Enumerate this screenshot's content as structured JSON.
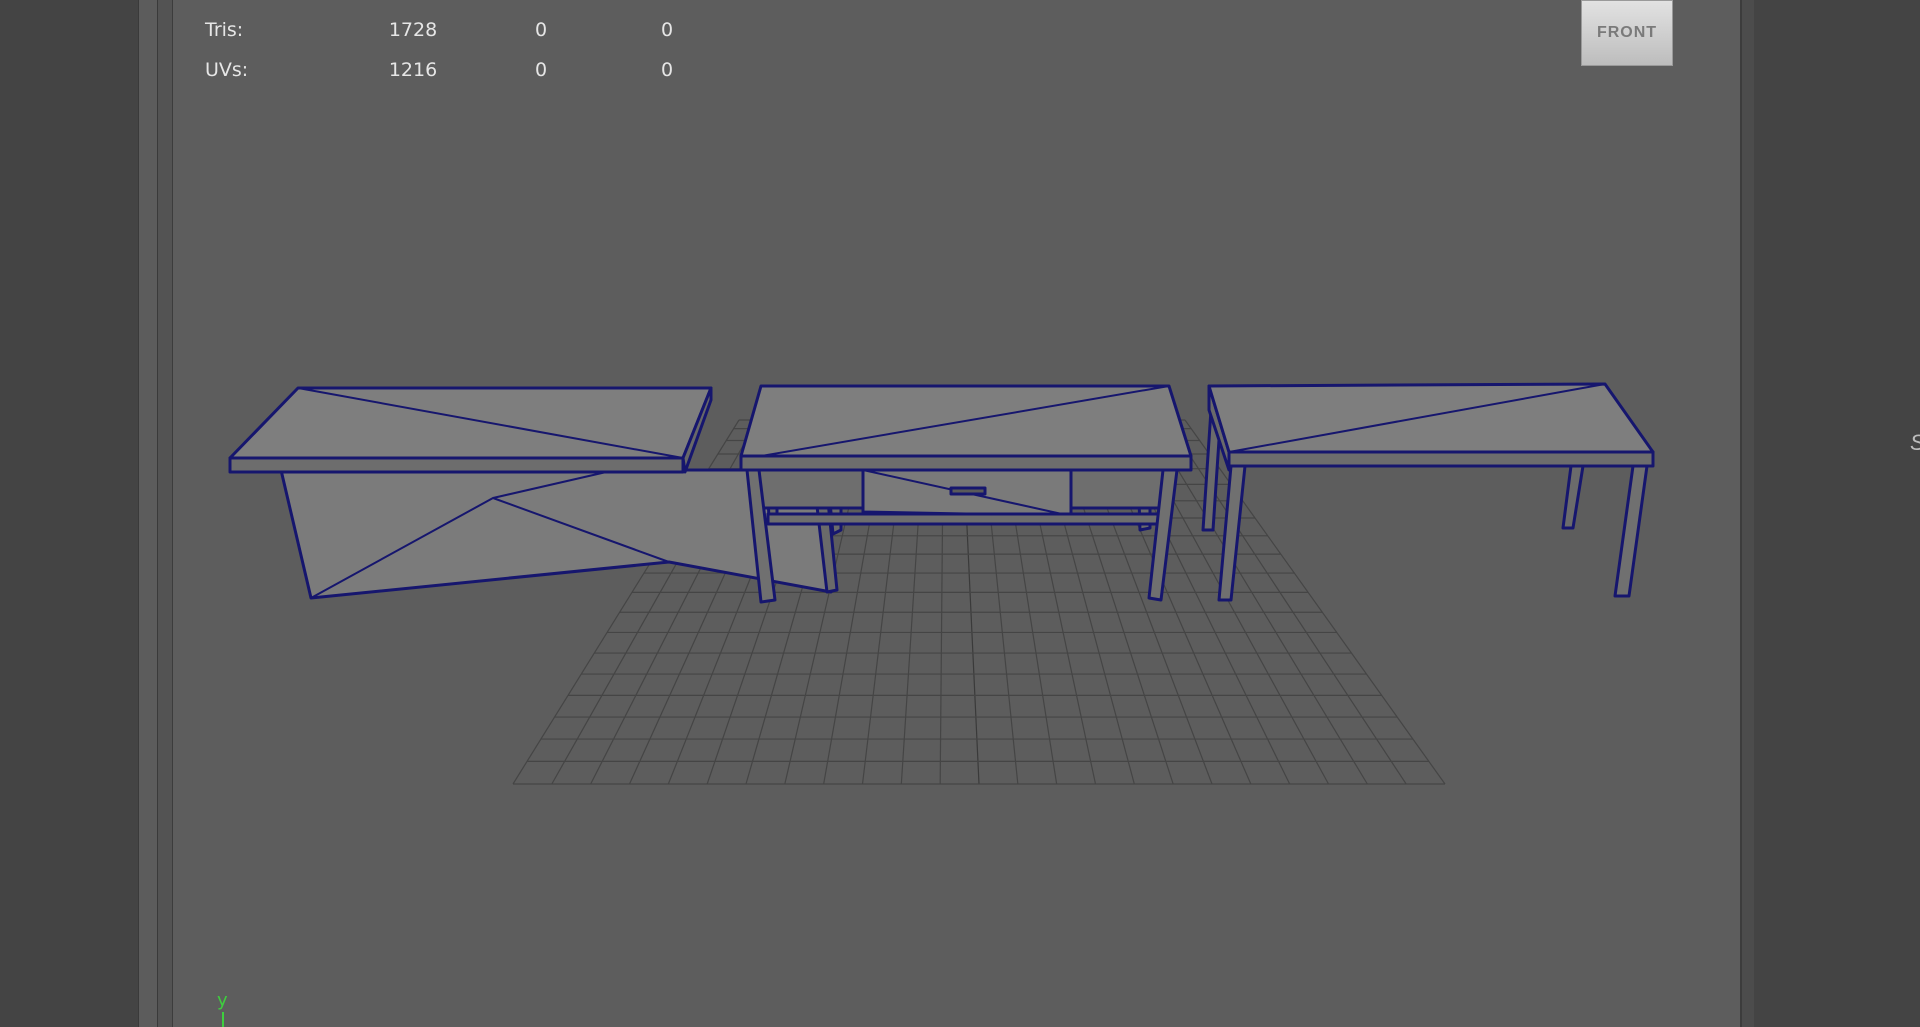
{
  "hud": {
    "rows": [
      {
        "label": "Tris:",
        "values": [
          "1728",
          "0",
          "0"
        ]
      },
      {
        "label": "UVs:",
        "values": [
          "1216",
          "0",
          "0"
        ]
      }
    ]
  },
  "viewcube": {
    "label": "FRONT"
  },
  "axis": {
    "label": "y"
  },
  "right_panel": {
    "glyph": "S"
  },
  "colors": {
    "viewport_bg": "#5d5d5d",
    "wireframe": "#16166e",
    "mesh_face": "#7a7a7a",
    "grid": "#444444",
    "axis_y": "#3ecf3e"
  },
  "scene": {
    "objects": [
      "side-table-panel",
      "coffee-table-drawer",
      "bench-table"
    ]
  }
}
